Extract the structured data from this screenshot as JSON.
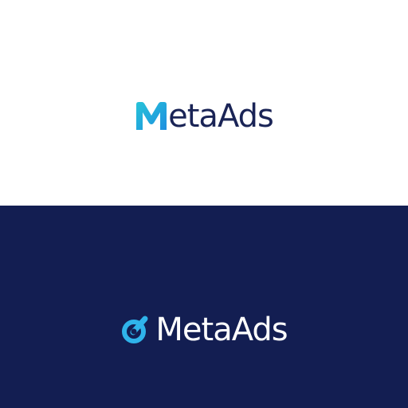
{
  "logo_light": {
    "brand_text": "etaAds",
    "mark_icon": "stylized-m-icon",
    "background_color": "#ffffff",
    "text_color": "#1a2456",
    "accent_colors": [
      "#1e8fe0",
      "#27c3d8"
    ]
  },
  "logo_dark": {
    "brand_text": "MetaAds",
    "mark_icon": "gauge-icon",
    "background_color": "#131e52",
    "text_color": "#ffffff",
    "accent_color": "#2fb3ea"
  }
}
